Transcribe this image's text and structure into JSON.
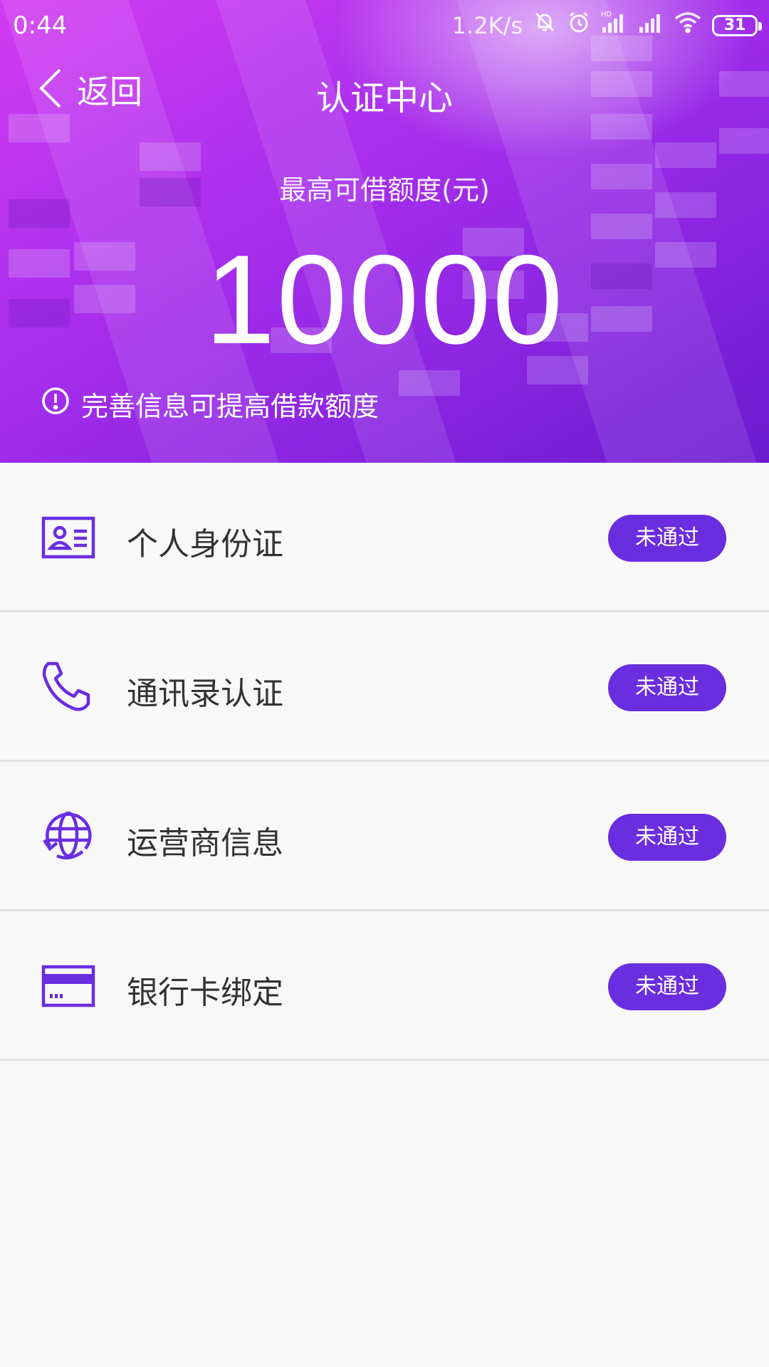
{
  "status_bar": {
    "time": "0:44",
    "net_speed": "1.2K/s",
    "battery": "31",
    "icons": [
      "bell-off-icon",
      "alarm-icon",
      "hd-signal-icon",
      "signal-icon",
      "wifi-icon",
      "battery-icon"
    ]
  },
  "nav": {
    "back_label": "返回",
    "title": "认证中心"
  },
  "credit": {
    "label": "最高可借额度(元)",
    "amount": "10000",
    "tip": "完善信息可提高借款额度"
  },
  "items": [
    {
      "label": "个人身份证",
      "status": "未通过",
      "icon": "id-card-icon"
    },
    {
      "label": "通讯录认证",
      "status": "未通过",
      "icon": "phone-icon"
    },
    {
      "label": "运营商信息",
      "status": "未通过",
      "icon": "globe-icon"
    },
    {
      "label": "银行卡绑定",
      "status": "未通过",
      "icon": "bank-card-icon"
    }
  ],
  "colors": {
    "accent": "#6a2de0",
    "header_start": "#d33cf2",
    "header_end": "#6c1bd0",
    "background": "#f8f8f9"
  }
}
